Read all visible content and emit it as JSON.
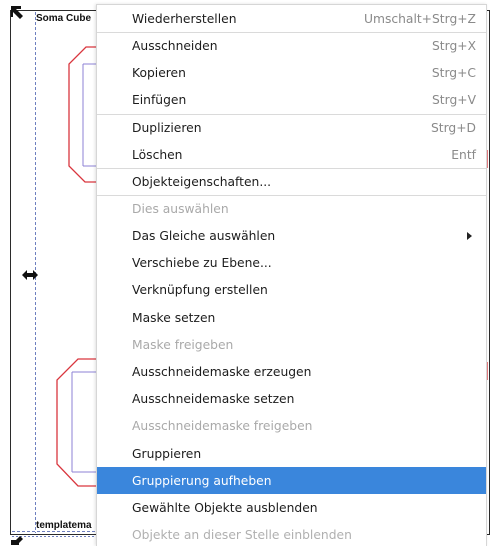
{
  "canvas": {
    "top_label": "Soma Cube",
    "bottom_label": "templatema"
  },
  "menu": {
    "items": [
      {
        "label": "Wiederherstellen",
        "shortcut": "Umschalt+Strg+Z",
        "state": "enabled"
      },
      {
        "label": "Ausschneiden",
        "shortcut": "Strg+X",
        "state": "enabled"
      },
      {
        "label": "Kopieren",
        "shortcut": "Strg+C",
        "state": "enabled"
      },
      {
        "label": "Einfügen",
        "shortcut": "Strg+V",
        "state": "enabled"
      },
      {
        "label": "Duplizieren",
        "shortcut": "Strg+D",
        "state": "enabled"
      },
      {
        "label": "Löschen",
        "shortcut": "Entf",
        "state": "enabled"
      },
      {
        "label": "Objekteigenschaften...",
        "shortcut": "",
        "state": "enabled"
      },
      {
        "label": "Dies auswählen",
        "shortcut": "",
        "state": "disabled"
      },
      {
        "label": "Das Gleiche auswählen",
        "shortcut": "",
        "state": "submenu"
      },
      {
        "label": "Verschiebe zu Ebene...",
        "shortcut": "",
        "state": "enabled"
      },
      {
        "label": "Verknüpfung erstellen",
        "shortcut": "",
        "state": "enabled"
      },
      {
        "label": "Maske setzen",
        "shortcut": "",
        "state": "enabled"
      },
      {
        "label": "Maske freigeben",
        "shortcut": "",
        "state": "disabled"
      },
      {
        "label": "Ausschneidemaske erzeugen",
        "shortcut": "",
        "state": "enabled"
      },
      {
        "label": "Ausschneidemaske setzen",
        "shortcut": "",
        "state": "enabled"
      },
      {
        "label": "Ausschneidemaske freigeben",
        "shortcut": "",
        "state": "disabled"
      },
      {
        "label": "Gruppieren",
        "shortcut": "",
        "state": "enabled"
      },
      {
        "label": "Gruppierung aufheben",
        "shortcut": "",
        "state": "highlighted"
      },
      {
        "label": "Gewählte Objekte ausblenden",
        "shortcut": "",
        "state": "enabled"
      },
      {
        "label": "Objekte an dieser Stelle einblenden",
        "shortcut": "",
        "state": "cut-off"
      }
    ]
  },
  "colors": {
    "highlight": "#3a86dc",
    "shape_outline_red": "#d9363e",
    "shape_outline_purple": "#8c82d6",
    "page_border": "#2b2b2b",
    "guide_dash": "#6e7fbf"
  }
}
